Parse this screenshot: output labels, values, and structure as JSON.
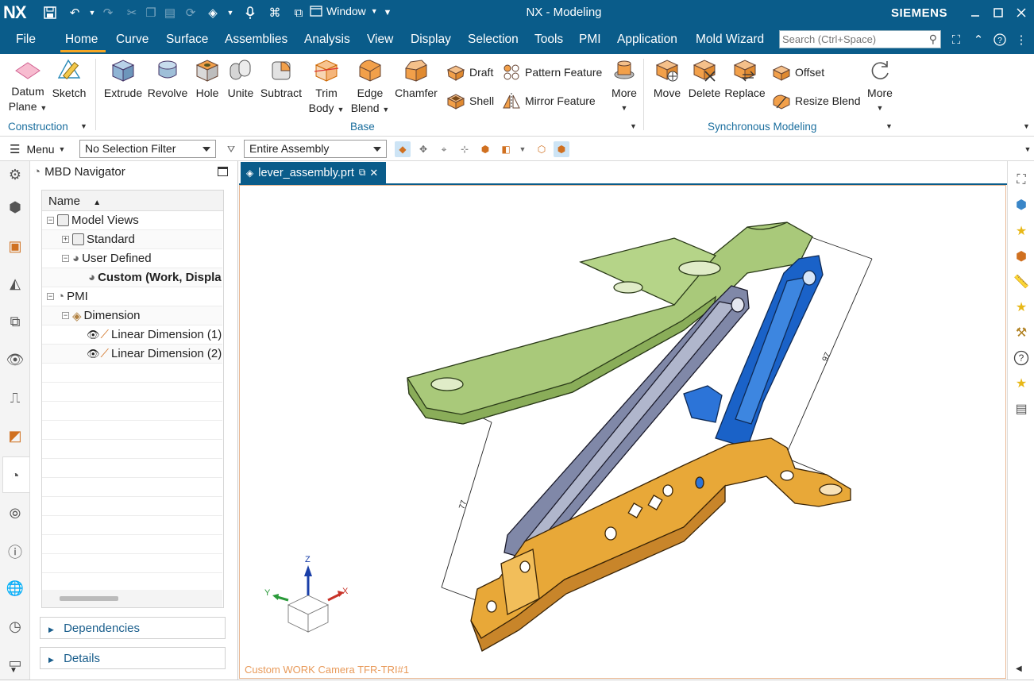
{
  "app": {
    "logo": "NX",
    "title": "NX - Modeling",
    "brand": "SIEMENS",
    "window_menu": "Window",
    "accent_color": "#0a5c8a"
  },
  "menu": {
    "items": [
      "File",
      "Home",
      "Curve",
      "Surface",
      "Assemblies",
      "Analysis",
      "View",
      "Display",
      "Selection",
      "Tools",
      "PMI",
      "Application",
      "Mold Wizard"
    ],
    "active": "Home",
    "search_placeholder": "Search (Ctrl+Space)"
  },
  "ribbon": {
    "datum_plane": [
      "Datum",
      "Plane"
    ],
    "sketch": "Sketch",
    "construction_group": "Construction",
    "extrude": "Extrude",
    "revolve": "Revolve",
    "hole": "Hole",
    "unite": "Unite",
    "subtract": "Subtract",
    "trim_body": [
      "Trim",
      "Body"
    ],
    "edge_blend": [
      "Edge",
      "Blend"
    ],
    "chamfer": "Chamfer",
    "draft": "Draft",
    "shell": "Shell",
    "pattern_feature": "Pattern Feature",
    "mirror_feature": "Mirror Feature",
    "more": "More",
    "base_group": "Base",
    "move": "Move",
    "delete": "Delete",
    "replace": "Replace",
    "offset": "Offset",
    "resize_blend": "Resize Blend",
    "more2": "More",
    "sync_group": "Synchronous Modeling"
  },
  "selection_bar": {
    "menu": "Menu",
    "filter": "No Selection Filter",
    "scope": "Entire Assembly"
  },
  "navigator": {
    "title": "MBD Navigator",
    "column": "Name",
    "tree": {
      "model_views": "Model Views",
      "standard": "Standard",
      "user_defined": "User Defined",
      "custom": "Custom (Work, Displa",
      "pmi": "PMI",
      "dimension": "Dimension",
      "lin1": "Linear Dimension (1)",
      "lin2": "Linear Dimension (2)"
    },
    "dependencies": "Dependencies",
    "details": "Details"
  },
  "viewport": {
    "tab_label": "lever_assembly.prt",
    "camera_label": "Custom WORK Camera TFR-TRI#1",
    "dim_97": "97",
    "dim_77": "77",
    "axis_z": "Z",
    "axis_x": "X",
    "axis_y": "Y"
  }
}
